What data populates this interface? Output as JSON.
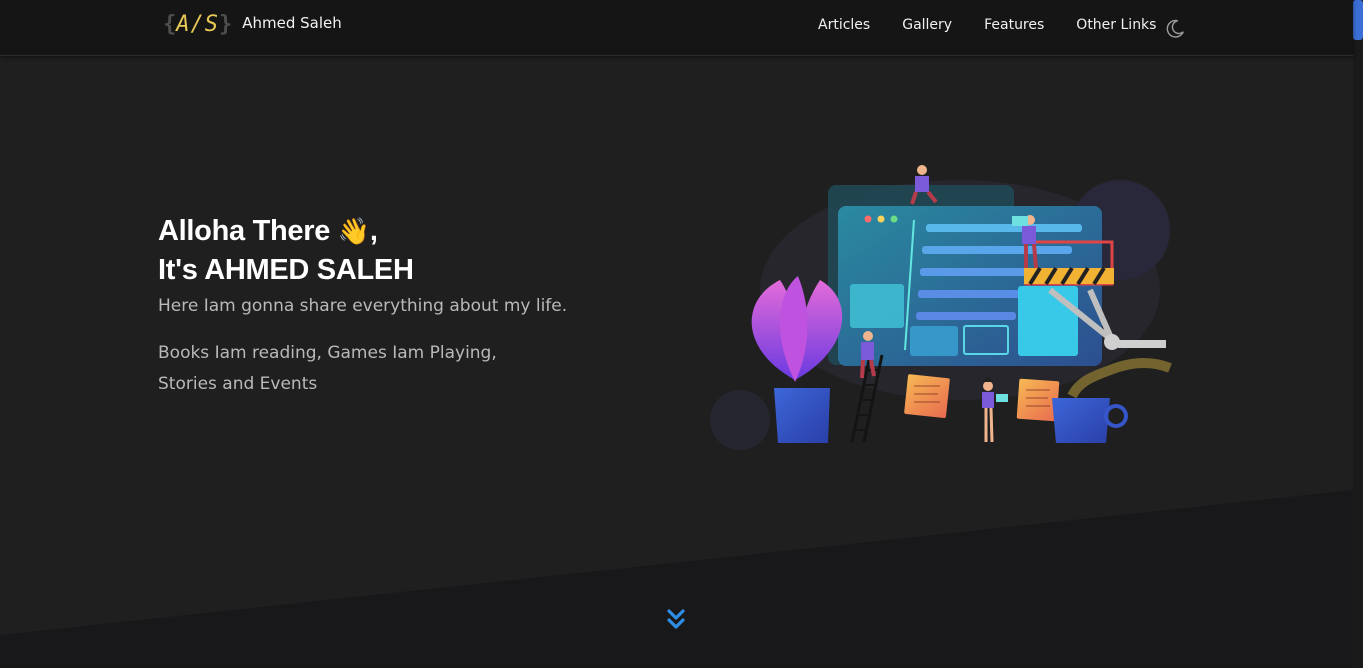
{
  "brand": {
    "logo_open": "{",
    "logo_initials": "A/S",
    "logo_close": "}",
    "name": "Ahmed Saleh"
  },
  "nav": {
    "links": [
      "Articles",
      "Gallery",
      "Features",
      "Other Links"
    ]
  },
  "hero": {
    "greeting_line1": "Alloha There",
    "wave_emoji": "👋",
    "greeting_comma": ",",
    "greeting_line2": "It's AHMED SALEH",
    "tagline": "Here Iam gonna share everything about my life.",
    "subtagline": "Books Iam reading, Games Iam Playing, Stories and Events"
  },
  "icons": {
    "theme_toggle": "moon-icon",
    "scroll_down": "double-chevron-down-icon"
  },
  "colors": {
    "background": "#1c1c1d",
    "navbar": "#151516",
    "accent": "#3b8ee0",
    "logo": "#e8c955"
  }
}
